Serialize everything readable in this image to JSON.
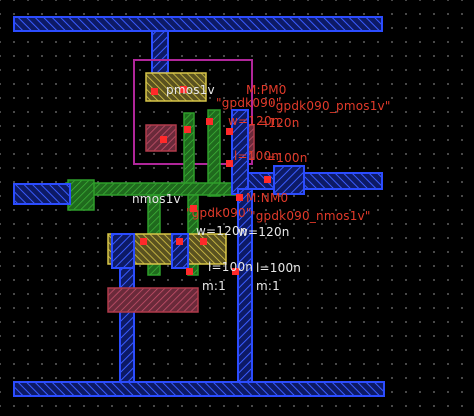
{
  "colors": {
    "background": "#000000",
    "grid_dot": "#5a5a5a",
    "metal1": "#2340d8",
    "poly": "#2e9e2a",
    "diffusion": "#c6b43a",
    "implant": "#b03a4a",
    "contact": "#ff2a2a",
    "well": "#b0269a",
    "text_white": "#e8e8e8",
    "text_red": "#e23a2a"
  },
  "pmos": {
    "cell_name": "pmos1v",
    "instance": "M:PM0",
    "library": "\"gpdk090\"",
    "model": "\"gpdk090_pmos1v\"",
    "width": "w=120n",
    "width2": "=120n",
    "length": "l=100n",
    "length2": "=100n"
  },
  "nmos": {
    "cell_name": "nmos1v",
    "instance": "M:NM0",
    "library": "\"gpdk090\"",
    "model": "\"gpdk090_nmos1v\"",
    "width": "w=120n",
    "width2": "w=120n",
    "length": "l=100n",
    "length2": "l=100n",
    "mult": "m:1",
    "mult2": "m:1"
  }
}
